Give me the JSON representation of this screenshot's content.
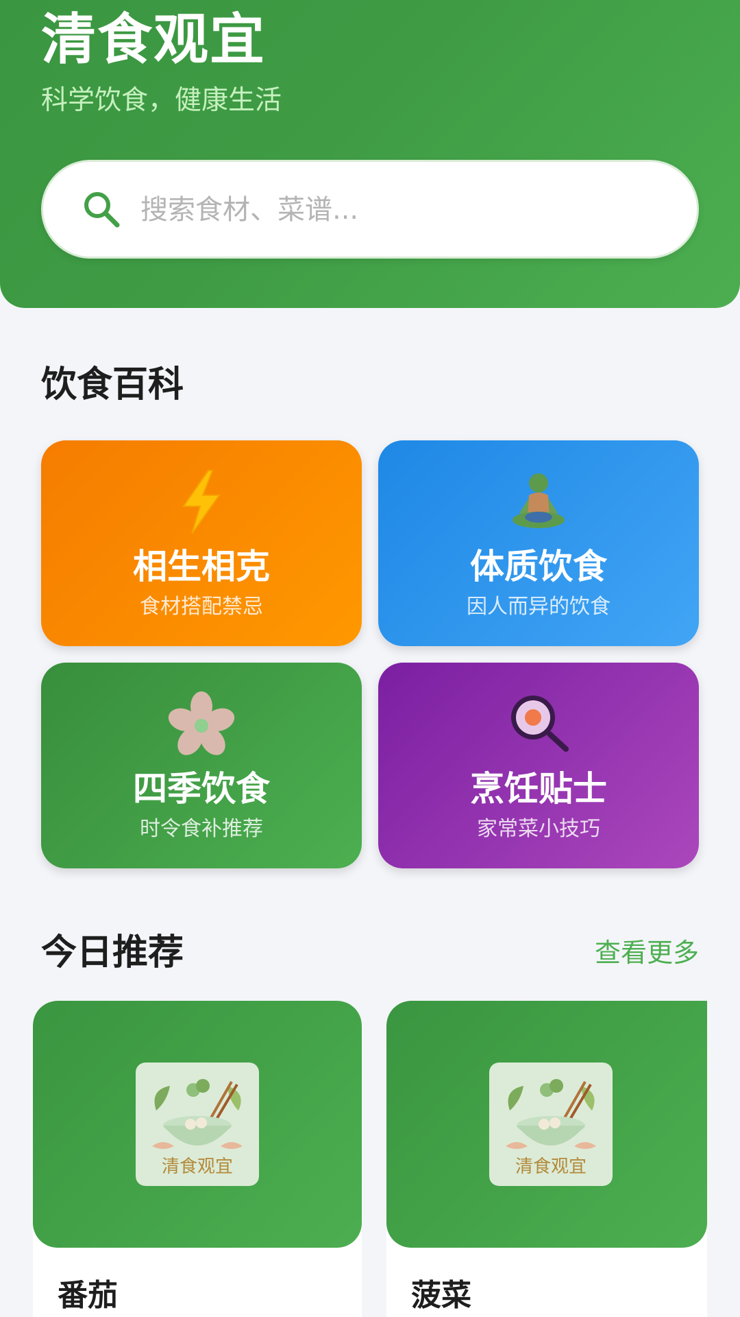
{
  "header": {
    "title": "清食观宜",
    "subtitle": "科学饮食，健康生活",
    "search_placeholder": "搜索食材、菜谱..."
  },
  "encyclopedia": {
    "title": "饮食百科",
    "cards": [
      {
        "name": "相生相克",
        "desc": "食材搭配禁忌",
        "icon": "lightning-icon",
        "color": "#f57c00"
      },
      {
        "name": "体质饮食",
        "desc": "因人而异的饮食",
        "icon": "meditation-icon",
        "color": "#1e88e5"
      },
      {
        "name": "四季饮食",
        "desc": "时令食补推荐",
        "icon": "blossom-icon",
        "color": "#388e3c"
      },
      {
        "name": "烹饪贴士",
        "desc": "家常菜小技巧",
        "icon": "fried-egg-magnifier-icon",
        "color": "#8e24aa"
      }
    ]
  },
  "recommend": {
    "title": "今日推荐",
    "more_label": "查看更多",
    "items": [
      {
        "name": "番茄",
        "logo_text": "清食观宜"
      },
      {
        "name": "菠菜",
        "logo_text": "清食观宜"
      }
    ]
  },
  "colors": {
    "brand_green": "#43a047",
    "accent_green": "#4caf50",
    "background": "#f4f5f9"
  }
}
